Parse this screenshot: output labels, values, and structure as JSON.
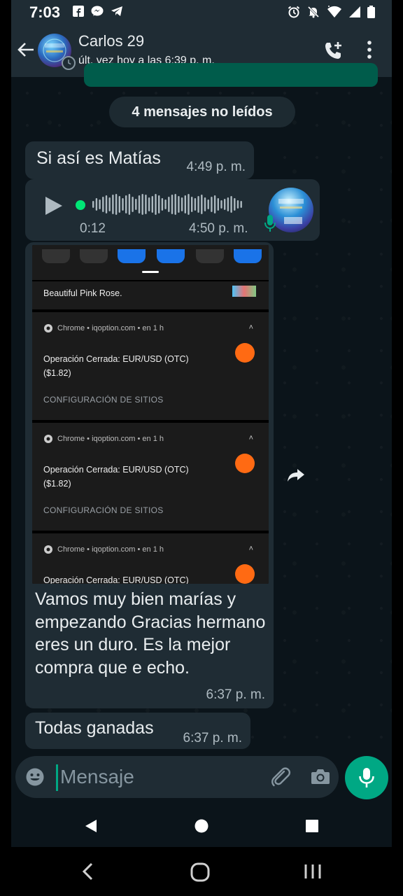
{
  "status_bar": {
    "time": "7:03",
    "left_icons": [
      "facebook-icon",
      "messenger-icon",
      "telegram-icon"
    ],
    "right_icons": [
      "alarm-icon",
      "mute-icon",
      "wifi-icon",
      "signal-icon",
      "battery-icon"
    ]
  },
  "header": {
    "contact_name": "Carlos 29",
    "last_seen": "últ. vez hoy a las 6:39 p. m.",
    "actions": [
      "back-arrow-icon",
      "add-call-icon",
      "more-menu-icon"
    ]
  },
  "chat": {
    "unread_banner": "4 mensajes no leídos",
    "messages": [
      {
        "type": "text",
        "text": "Si así es Matías",
        "time": "4:49 p. m."
      },
      {
        "type": "voice",
        "duration": "0:12",
        "time": "4:50 p. m."
      },
      {
        "type": "image",
        "screenshot": {
          "top_notification": "Beautiful Pink Rose.",
          "notifications": [
            {
              "source": "Chrome • iqoption.com • en 1 h",
              "title": "Operación Cerrada: EUR/USD (OTC)",
              "amount": "($1.82)",
              "action": "CONFIGURACIÓN DE SITIOS"
            },
            {
              "source": "Chrome • iqoption.com • en 1 h",
              "title": "Operación Cerrada: EUR/USD (OTC)",
              "amount": "($1.82)",
              "action": "CONFIGURACIÓN DE SITIOS"
            },
            {
              "source": "Chrome • iqoption.com • en 1 h",
              "title": "Operación Cerrada: EUR/USD (OTC)",
              "amount": "",
              "action": ""
            }
          ]
        },
        "caption": "Vamos muy bien marías y empezando Gracias hermano eres un duro. Es la mejor compra que e echo.",
        "time": "6:37 p. m."
      },
      {
        "type": "text",
        "text": "Todas ganadas",
        "time": "6:37 p. m."
      }
    ]
  },
  "composer": {
    "placeholder": "Mensaje",
    "icons": [
      "emoji-icon",
      "attach-clip-icon",
      "camera-icon",
      "microphone-icon"
    ]
  },
  "colors": {
    "background": "#0b141a",
    "bar": "#1f2c34",
    "bubble_incoming": "#1f2c34",
    "accent": "#00a884",
    "timestamp": "#aebac1"
  }
}
